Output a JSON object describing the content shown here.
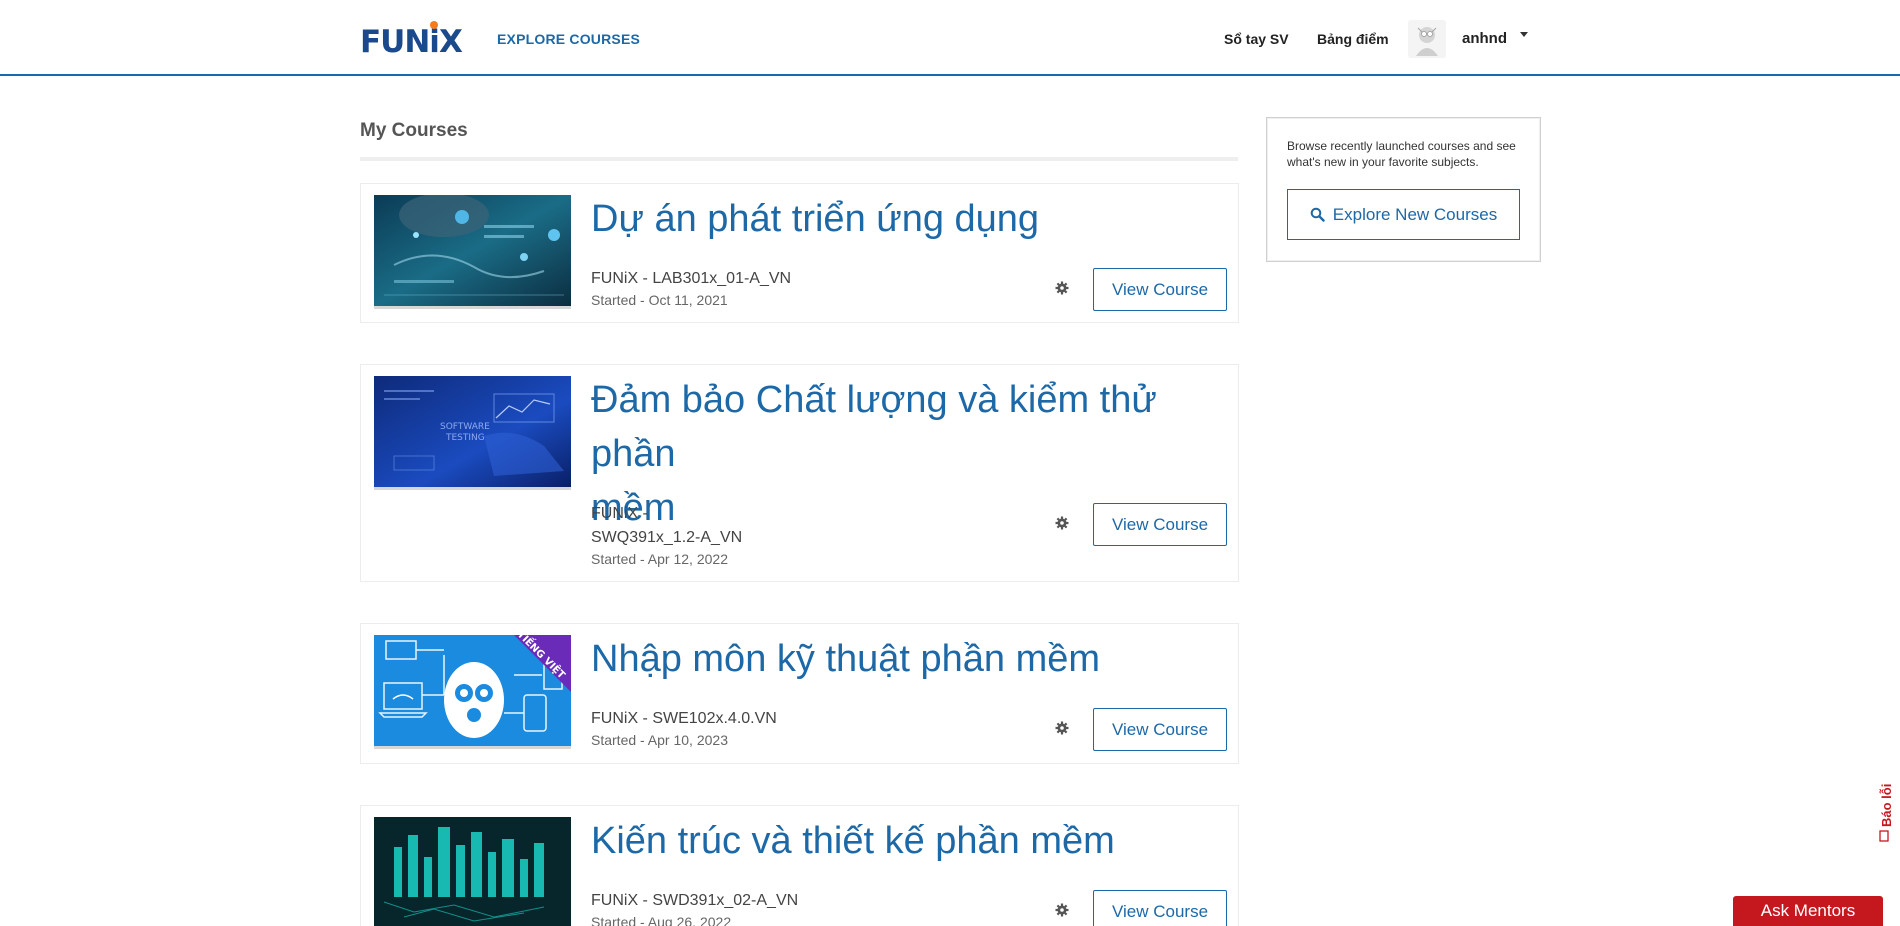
{
  "header": {
    "logo_text": "FUNiX",
    "explore_label": "EXPLORE COURSES",
    "so_tay_label": "Sổ tay SV",
    "bang_diem_label": "Bảng điểm",
    "username": "anhnd"
  },
  "main": {
    "title": "My Courses",
    "view_button_label": "View Course",
    "courses": [
      {
        "title": "Dự án phát triển ứng dụng",
        "code": "FUNiX - LAB301x_01-A_VN",
        "started": "Started - Oct 11, 2021"
      },
      {
        "title_line1": "Đảm bảo Chất lượng và kiểm thử phần",
        "title_line2": "mềm",
        "code_line1": "FUNiX -",
        "code_line2": "SWQ391x_1.2-A_VN",
        "started": "Started - Apr 12, 2022",
        "thumb_text": "SOFTWARE TESTING"
      },
      {
        "title": "Nhập môn kỹ thuật phần mềm",
        "code": "FUNiX - SWE102x.4.0.VN",
        "started": "Started - Apr 10, 2023",
        "ribbon": "TIẾNG VIỆT"
      },
      {
        "title": "Kiến trúc và thiết kế phần mềm",
        "code": "FUNiX - SWD391x_02-A_VN",
        "started": "Started - Aug 26, 2022"
      }
    ]
  },
  "sidebar": {
    "text": "Browse recently launched courses and see what's new in your favorite subjects.",
    "explore_button": "Explore New Courses"
  },
  "floating": {
    "bao_loi": "Báo lỗi",
    "ask_mentors": "Ask Mentors"
  },
  "colors": {
    "primary": "#1d68a7",
    "logo_blue": "#1a4a8c",
    "logo_orange": "#f27c1e",
    "ask_red": "#c5181e"
  }
}
